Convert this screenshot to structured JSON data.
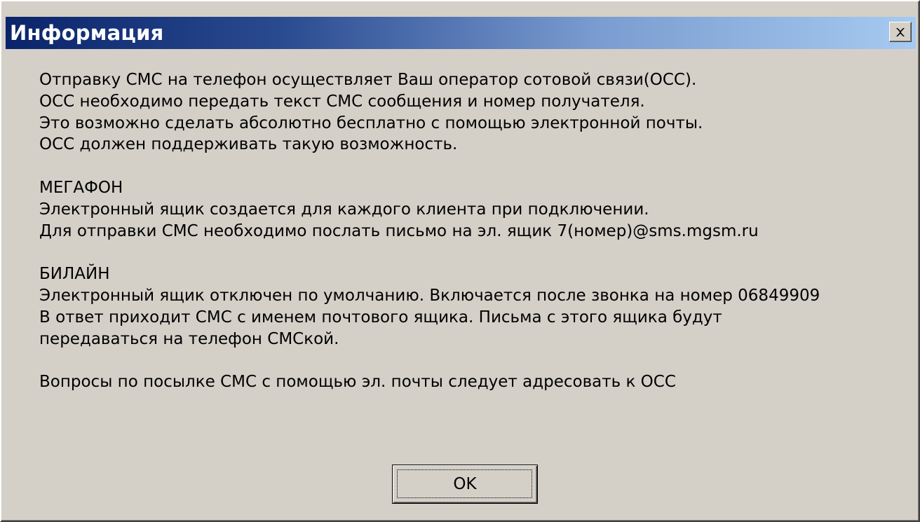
{
  "window": {
    "title": "Информация"
  },
  "message": {
    "lines": [
      "Отправку СМС на телефон осуществляет Ваш оператор сотовой связи(ОСС).",
      "ОСС необходимо передать текст СМС сообщения и номер получателя.",
      "Это возможно сделать абсолютно бесплатно с помощью электронной почты.",
      "ОСС должен поддерживать такую возможность.",
      "МЕГАФОН",
      "Электронный ящик создается для каждого клиента при подключении.",
      "Для отправки СМС необходимо послать письмо на эл. ящик 7(номер)@sms.mgsm.ru",
      "БИЛАЙН",
      "Электронный ящик отключен по умолчанию. Включается после звонка на номер 06849909",
      "В ответ приходит СМС с именем почтового ящика. Письма с этого ящика будут",
      "передаваться на телефон СМСкой.",
      "Вопросы по посылке СМС с помощью эл. почты следует адресовать к ОСС"
    ]
  },
  "buttons": {
    "ok_label": "OK"
  },
  "icons": {
    "close": "close-icon"
  },
  "colors": {
    "titlebar_start": "#0a246a",
    "titlebar_end": "#a6caf0",
    "face": "#d4d0c8"
  }
}
